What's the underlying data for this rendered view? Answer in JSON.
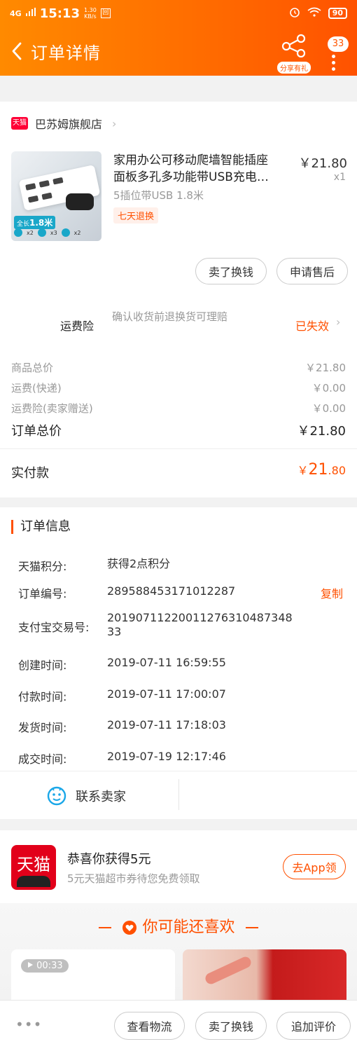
{
  "status_bar": {
    "network": "4G",
    "speed": "1.30",
    "speed_unit": "KB/s",
    "time": "15:13",
    "battery": "90"
  },
  "nav": {
    "title": "订单详情",
    "share_label": "分享有礼",
    "message_count": "33"
  },
  "shop": {
    "badge": "天猫",
    "name": "巴苏姆旗舰店"
  },
  "product": {
    "title_line1": "家用办公可移动爬墙智能插座",
    "title_line2": "面板多孔多功能带USB充电…",
    "spec": "5插位带USB 1.8米",
    "return_tag": "七天退换",
    "price": "￥21.80",
    "qty": "x1",
    "thumb_tag_prefix": "全长",
    "thumb_tag_len": "1.8米",
    "thumb_icons": [
      "x2",
      "x3",
      "x2"
    ]
  },
  "actions": {
    "sell_exchange": "卖了换钱",
    "after_sale": "申请售后"
  },
  "insurance": {
    "label": "运费险",
    "desc": "确认收货前退换货可理赔",
    "status": "已失效"
  },
  "fees": [
    {
      "label": "商品总价",
      "value": "￥21.80"
    },
    {
      "label": "运费(快递)",
      "value": "￥0.00"
    },
    {
      "label": "运费险(卖家赠送)",
      "value": "￥0.00"
    }
  ],
  "total": {
    "label": "订单总价",
    "value": "￥21.80"
  },
  "paid": {
    "label": "实付款",
    "yen": "￥",
    "int": "21",
    "dec": ".80"
  },
  "order_info": {
    "title": "订单信息",
    "rows": [
      {
        "label": "天猫积分:",
        "value": "获得2点积分"
      },
      {
        "label": "订单编号:",
        "value": "289588453171012287"
      },
      {
        "label": "支付宝交易号:",
        "value": "2019071122001127631048734833"
      },
      {
        "label": "创建时间:",
        "value": "2019-07-11 16:59:55"
      },
      {
        "label": "付款时间:",
        "value": "2019-07-11 17:00:07"
      },
      {
        "label": "发货时间:",
        "value": "2019-07-11 17:18:03"
      },
      {
        "label": "成交时间:",
        "value": "2019-07-19 12:17:46"
      }
    ],
    "copy_label": "复制"
  },
  "contact": {
    "label": "联系卖家"
  },
  "promo": {
    "logo": "天猫",
    "title": "恭喜你获得5元",
    "subtitle": "5元天猫超市券待您免费领取",
    "button": "去App领"
  },
  "recommend": {
    "title": "你可能还喜欢",
    "video_duration": "00:33"
  },
  "bottom_bar": {
    "more": "•••",
    "logistics": "查看物流",
    "sell_exchange": "卖了换钱",
    "review": "追加评价"
  },
  "colors": {
    "accent": "#ff5000",
    "header_start": "#ff8a00",
    "header_end": "#ff5200",
    "tmall_red": "#e2001a"
  }
}
